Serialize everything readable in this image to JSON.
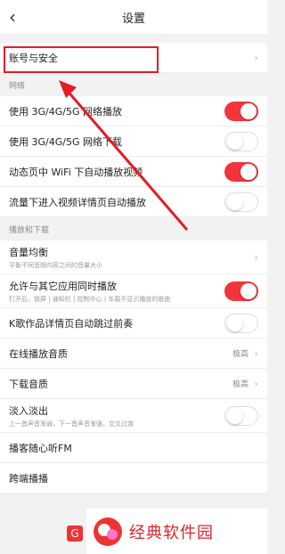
{
  "header": {
    "title": "设置",
    "back_icon": "chevron-left-icon"
  },
  "account_row": {
    "label": "账号与安全"
  },
  "network": {
    "header": "网络",
    "items": [
      {
        "label": "使用 3G/4G/5G 网络播放",
        "toggle": "on"
      },
      {
        "label": "使用 3G/4G/5G 网络下载",
        "toggle": "off"
      },
      {
        "label": "动态页中 WiFi 下自动播放视频",
        "toggle": "on"
      },
      {
        "label": "流量下进入视频详情页自动播放",
        "toggle": "off"
      }
    ]
  },
  "playback": {
    "header": "播放和下载",
    "items": [
      {
        "label": "音量均衡",
        "sub": "平衡不同音频内容之间的音量大小",
        "right": "chevron"
      },
      {
        "label": "允许与其它应用同时播放",
        "sub": "打开后，锁屏 | 通知栏 | 控制中心 | 车载不显示播放的歌曲",
        "toggle": "on"
      },
      {
        "label": "K歌作品详情页自动跳过前奏",
        "toggle": "off"
      },
      {
        "label": "在线播放音质",
        "value": "极高"
      },
      {
        "label": "下载音质",
        "value": "极高"
      },
      {
        "label": "淡入淡出",
        "sub": "上一首声音渐弱，下一首声音渐强，交叉过渡",
        "toggle": "off"
      },
      {
        "label": "播客随心听FM"
      },
      {
        "label": "跨端播播"
      }
    ]
  },
  "watermark": {
    "text": "经典软件园",
    "badge": "G"
  },
  "colors": {
    "accent": "#f2353c",
    "annotation": "#e31c25"
  }
}
